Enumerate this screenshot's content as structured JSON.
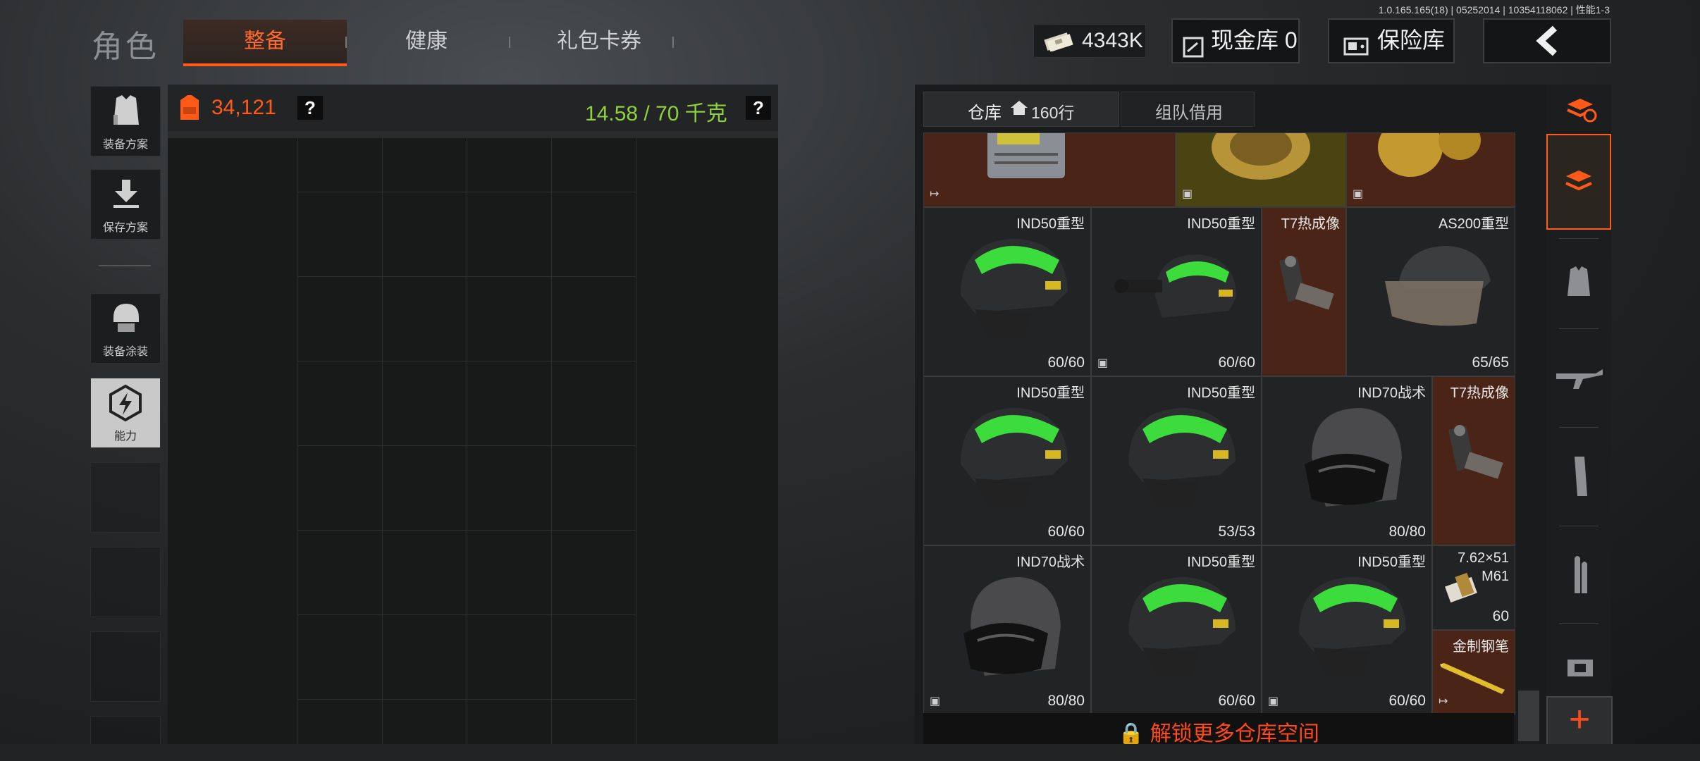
{
  "version": "1.0.165.165(18) | 05252014 | 10354118062 | 性能1-3",
  "page_title": "角色",
  "tabs": [
    {
      "label": "整备",
      "active": true
    },
    {
      "label": "健康",
      "active": false
    },
    {
      "label": "礼包卡券",
      "active": false
    }
  ],
  "currency": {
    "amount": "4343K",
    "icon": "cash-stack-icon"
  },
  "header_buttons": {
    "cash_vault": "现金库 0",
    "safe": "保险库",
    "back_icon": "chevron-left-icon"
  },
  "sidebar": {
    "items": [
      {
        "label": "装备方案",
        "icon": "vest-icon"
      },
      {
        "label": "保存方案",
        "icon": "download-icon"
      },
      {
        "label": "装备涂装",
        "icon": "helmet-paint-icon"
      },
      {
        "label": "能力",
        "icon": "ability-hex-icon"
      }
    ]
  },
  "inventory": {
    "value": "34,121",
    "help": "?",
    "weight": "14.58 / 70 千克",
    "weight_help": "?"
  },
  "warehouse": {
    "tab_warehouse": "仓库",
    "tab_rows": "160行",
    "tab_team": "组队借用",
    "items": [
      {
        "name": "",
        "durability": "",
        "color": "brown"
      },
      {
        "name": "",
        "durability": "",
        "color": "olive"
      },
      {
        "name": "",
        "durability": "",
        "color": "brown"
      },
      {
        "name": "IND50重型",
        "durability": "60/60"
      },
      {
        "name": "IND50重型",
        "durability": "60/60"
      },
      {
        "name": "T7热成像",
        "durability": ""
      },
      {
        "name": "AS200重型",
        "durability": "65/65"
      },
      {
        "name": "IND50重型",
        "durability": "60/60"
      },
      {
        "name": "IND50重型",
        "durability": "53/53"
      },
      {
        "name": "IND70战术",
        "durability": "80/80"
      },
      {
        "name": "T7热成像",
        "durability": ""
      },
      {
        "name": "IND70战术",
        "durability": "80/80"
      },
      {
        "name": "IND50重型",
        "durability": "60/60"
      },
      {
        "name": "IND50重型",
        "durability": "60/60"
      },
      {
        "name": "7.62×51",
        "subname": "M61",
        "durability": "60"
      },
      {
        "name": "金制钢笔",
        "durability": ""
      }
    ],
    "unlock_label": "解锁更多仓库空间"
  },
  "categories": [
    "stack-refresh-icon",
    "layers-icon",
    "armor-vest-icon",
    "rifle-icon",
    "magazine-icon",
    "ammo-icon",
    "gear-icon"
  ],
  "plus_label": "+",
  "colors": {
    "accent": "#ff5a17",
    "weight_green": "#8ed13a",
    "brown_cell": "#4a2517"
  }
}
